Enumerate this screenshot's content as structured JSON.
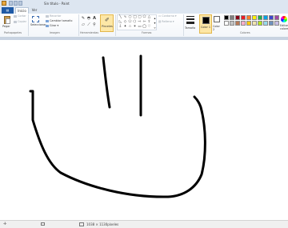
{
  "window": {
    "title": "Sin título - Paint"
  },
  "ribbon_tabs": {
    "file": "",
    "home": "Inicio",
    "view": "Ver"
  },
  "clipboard": {
    "paste": "Pegar",
    "cut": "Cortar",
    "copy": "Copiar",
    "group": "Portapapeles"
  },
  "image": {
    "select": "Seleccionar",
    "crop": "Recortar",
    "resize": "Cambiar tamaño",
    "rotate": "Girar",
    "group": "Imagen"
  },
  "tools": {
    "group": "Herramientas",
    "brushes": "Pinceles"
  },
  "shapes": {
    "outline": "Contorno",
    "fill": "Relleno",
    "group": "Formas"
  },
  "size": {
    "label": "Tamaño"
  },
  "colors": {
    "color1": "Color 1",
    "color2": "Color 2",
    "edit": "Editar colores",
    "group": "Colores",
    "palette": [
      "#000000",
      "#7f7f7f",
      "#880015",
      "#ed1c24",
      "#ff7f27",
      "#fff200",
      "#22b14c",
      "#00a2e8",
      "#3f48cc",
      "#a349a4",
      "#ffffff",
      "#c3c3c3",
      "#b97a57",
      "#ffaec9",
      "#ffc90e",
      "#efe4b0",
      "#b5e61d",
      "#99d9ea",
      "#7092be",
      "#c8bfe7"
    ]
  },
  "status": {
    "canvas_size": "1038 × 1130píxeles"
  }
}
